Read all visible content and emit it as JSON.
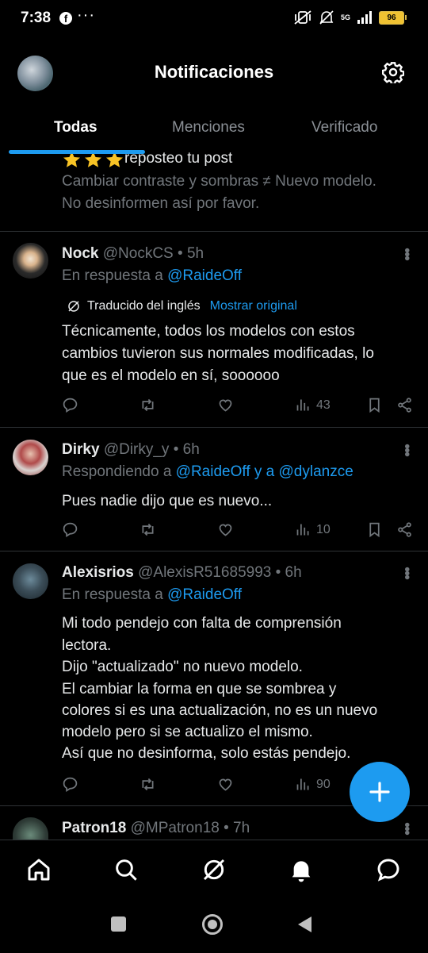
{
  "status_bar": {
    "time": "7:38",
    "fb_icon": "f",
    "dots": "···",
    "network": "5G",
    "battery": "96"
  },
  "header": {
    "title": "Notificaciones"
  },
  "tabs": [
    {
      "label": "Todas",
      "active": true
    },
    {
      "label": "Menciones",
      "active": false
    },
    {
      "label": "Verificado",
      "active": false
    }
  ],
  "posts": [
    {
      "repost_line": "reposteo tu post",
      "body_lines": [
        "Cambiar contraste y sombras ≠ Nuevo modelo.",
        "No desinformen así por favor."
      ]
    },
    {
      "name": "Nock",
      "handle": "@NockCS",
      "time": "• 5h",
      "reply_prefix": "En respuesta a",
      "reply_to": "@RaideOff",
      "translated_label": "Traducido del inglés",
      "show_original": "Mostrar original",
      "body_lines": [
        "Técnicamente, todos los modelos con estos",
        "cambios tuvieron sus normales modificadas, lo",
        "que es el modelo en sí, soooooo"
      ],
      "views": "43"
    },
    {
      "name": "Dirky",
      "handle": "@Dirky_y",
      "time": "• 6h",
      "reply_prefix": "Respondiendo a",
      "reply_to": "@RaideOff y a @dylanzce",
      "body_lines": [
        "Pues nadie dijo que es nuevo..."
      ],
      "views": "10"
    },
    {
      "name": "Alexisrios",
      "handle": "@AlexisR51685993",
      "time": "• 6h",
      "reply_prefix": "En respuesta a",
      "reply_to": "@RaideOff",
      "body_lines": [
        "Mi todo pendejo con falta de comprensión",
        "lectora.",
        "Dijo \"actualizado\" no nuevo modelo.",
        "El cambiar la forma en que se sombrea y",
        "colores si es una actualización, no es un nuevo",
        "modelo pero si se actualizo el mismo.",
        "Así que no desinforma, solo estás pendejo."
      ],
      "views": "90"
    },
    {
      "name": "Patron18",
      "handle": "@MPatron18",
      "time": "• 7h"
    }
  ],
  "colors": {
    "accent": "#1d9bf0",
    "muted": "#71767b",
    "text": "#e7e9ea",
    "star": "#f7c325"
  },
  "icons": [
    "home-icon",
    "search-icon",
    "grok-icon",
    "bell-icon",
    "messages-icon",
    "gear-icon",
    "compose-plus-icon"
  ]
}
